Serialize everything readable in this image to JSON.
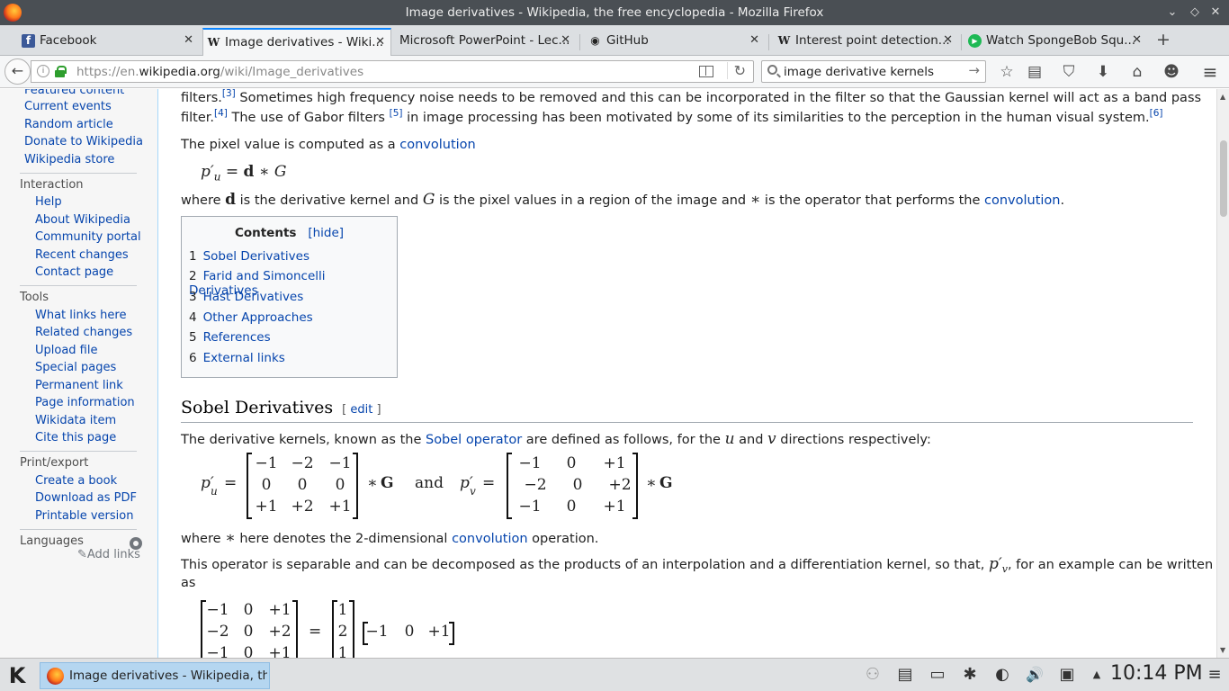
{
  "window": {
    "title": "Image derivatives - Wikipedia, the free encyclopedia - Mozilla Firefox",
    "controls": {
      "minimize": "⌄",
      "maximize": "◇",
      "close": "✕"
    }
  },
  "tabs": [
    {
      "label": "Facebook",
      "favicon": "f",
      "favicon_color": "#3b5998",
      "close": "✕"
    },
    {
      "label": "Image derivatives - Wiki...",
      "favicon": "W",
      "favicon_color": "#222222",
      "close": "✕"
    },
    {
      "label": "Microsoft PowerPoint - Lec...",
      "favicon": "",
      "favicon_color": "#ffffff",
      "close": "✕"
    },
    {
      "label": "GitHub",
      "favicon": "◉",
      "favicon_color": "#111111",
      "close": "✕"
    },
    {
      "label": "Interest point detection...",
      "favicon": "W",
      "favicon_color": "#222222",
      "close": "✕"
    },
    {
      "label": "Watch SpongeBob Squ...",
      "favicon": "▶",
      "favicon_color": "#1db954",
      "close": "✕"
    }
  ],
  "newtab": "+",
  "nav": {
    "back": "←",
    "info": "i",
    "url_prefix": "https://en.",
    "url_domain": "wikipedia.org",
    "url_path": "/wiki/Image_derivatives",
    "reload": "↻",
    "search_value": "image derivative kernels",
    "search_go": "→"
  },
  "toolbar_icons": [
    "☆",
    "▤",
    "⛉",
    "⬇",
    "⌂",
    "☻",
    "≡"
  ],
  "sidebar": {
    "nav_links": [
      "Featured content",
      "Current events",
      "Random article",
      "Donate to Wikipedia",
      "Wikipedia store"
    ],
    "interaction_head": "Interaction",
    "interaction_links": [
      "Help",
      "About Wikipedia",
      "Community portal",
      "Recent changes",
      "Contact page"
    ],
    "tools_head": "Tools",
    "tools_links": [
      "What links here",
      "Related changes",
      "Upload file",
      "Special pages",
      "Permanent link",
      "Page information",
      "Wikidata item",
      "Cite this page"
    ],
    "print_head": "Print/export",
    "print_links": [
      "Create a book",
      "Download as PDF",
      "Printable version"
    ],
    "languages_head": "Languages",
    "add_links": "✎Add links"
  },
  "article": {
    "p1_a": "filters.",
    "ref3": "[3]",
    "p1_b": " Sometimes high frequency noise needs to be removed and this can be incorporated in the filter so that the Gaussian kernel will act as a band pass",
    "p2_a": "filter.",
    "ref4": "[4]",
    "p2_b": " The use of Gabor filters ",
    "ref5": "[5]",
    "p2_c": " in image processing has been motivated by some of its similarities to the perception in the human visual system.",
    "ref6": "[6]",
    "p3_a": "The pixel value is computed as a ",
    "p3_link": "convolution",
    "eq1": "p′",
    "eq1_sub": "u",
    "eq1_rest": " = ",
    "eq1_d": "d",
    "eq1_star": " ∗ ",
    "eq1_g": "G",
    "p4_a": "where ",
    "p4_d": "d",
    "p4_b": " is the derivative kernel and ",
    "p4_g": "G",
    "p4_c": " is the pixel values in a region of the image and ",
    "p4_star": "∗",
    "p4_d2": " is the operator that performs the ",
    "p4_link": "convolution",
    "p4_end": ".",
    "toc_title": "Contents",
    "toc_hide": "[hide]",
    "toc": [
      {
        "num": "1",
        "label": "Sobel Derivatives"
      },
      {
        "num": "2",
        "label": "Farid and Simoncelli Derivatives"
      },
      {
        "num": "3",
        "label": "Hast Derivatives"
      },
      {
        "num": "4",
        "label": "Other Approaches"
      },
      {
        "num": "5",
        "label": "References"
      },
      {
        "num": "6",
        "label": "External links"
      }
    ],
    "h2": "Sobel Derivatives",
    "h2_edit_open": "[ ",
    "h2_edit": "edit",
    "h2_edit_close": " ]",
    "p5_a": "The derivative kernels, known as the ",
    "p5_link": "Sobel operator",
    "p5_b": " are defined as follows, for the ",
    "p5_u": "u",
    "p5_and": " and ",
    "p5_v": "v",
    "p5_c": " directions respectively:",
    "eq2_pu": "p′",
    "eq2_pu_sub": "u",
    "eq2_eq": "=",
    "eq2_mu": [
      [
        "−1",
        "−2",
        "−1"
      ],
      [
        "0",
        "0",
        "0"
      ],
      [
        "+1",
        "+2",
        "+1"
      ]
    ],
    "eq2_star": "∗",
    "eq2_G": "G",
    "eq2_and": "and",
    "eq2_pv": "p′",
    "eq2_pv_sub": "v",
    "eq2_mv": [
      [
        "−1",
        "0",
        "+1"
      ],
      [
        "−2",
        "0",
        "+2"
      ],
      [
        "−1",
        "0",
        "+1"
      ]
    ],
    "p6_a": "where ",
    "p6_star": "∗",
    "p6_b": " here denotes the 2-dimensional ",
    "p6_link": "convolution",
    "p6_c": " operation.",
    "p7_a": "This operator is separable and can be decomposed as the products of an interpolation and a differentiation kernel, so that, ",
    "p7_pv": "p′",
    "p7_pv_sub": "v",
    "p7_b": ", for an example can be written",
    "p7_c": "as",
    "eq3_m": [
      [
        "−1",
        "0",
        "+1"
      ],
      [
        "−2",
        "0",
        "+2"
      ],
      [
        "−1",
        "0",
        "+1"
      ]
    ],
    "eq3_eq": "=",
    "eq3_col": [
      "1",
      "2",
      "1"
    ],
    "eq3_row": [
      "−1",
      "0",
      "+1"
    ]
  },
  "scrollbar": {
    "up": "▲",
    "down": "▼"
  },
  "taskbar": {
    "start": "K",
    "task_label": "Image derivatives - Wikipedia, the fr",
    "tray": [
      "⚇",
      "▤",
      "▭",
      "✱",
      "◐",
      "🔊",
      "▣",
      "▲",
      "≡"
    ],
    "clock": "10:14 PM"
  }
}
